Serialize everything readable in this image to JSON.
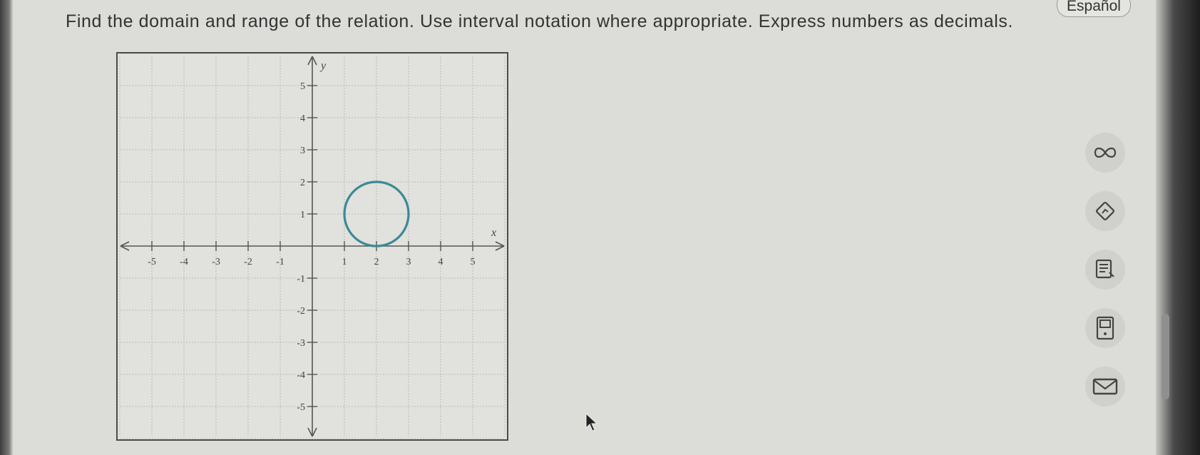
{
  "question": {
    "text": "Find the domain and range of the relation. Use interval notation where appropriate. Express numbers as decimals."
  },
  "language_button": {
    "label": "Español"
  },
  "graph": {
    "x_axis_label": "x",
    "y_axis_label": "y",
    "x_ticks": [
      "-5",
      "-4",
      "-3",
      "-2",
      "-1",
      "1",
      "2",
      "3",
      "4",
      "5"
    ],
    "y_ticks": [
      "5",
      "4",
      "3",
      "2",
      "1",
      "-1",
      "-2",
      "-3",
      "-4",
      "-5"
    ]
  },
  "chart_data": {
    "type": "scatter",
    "title": "",
    "xlabel": "x",
    "ylabel": "y",
    "xlim": [
      -6,
      6
    ],
    "ylim": [
      -6,
      6
    ],
    "grid": true,
    "relation": {
      "shape": "circle",
      "center": [
        2,
        1
      ],
      "radius": 1,
      "color": "#3a8a96"
    }
  },
  "toolbar": {
    "icons": [
      "infinity-icon",
      "calculator-hint-icon",
      "notes-icon",
      "calculator-icon",
      "mail-icon"
    ]
  }
}
